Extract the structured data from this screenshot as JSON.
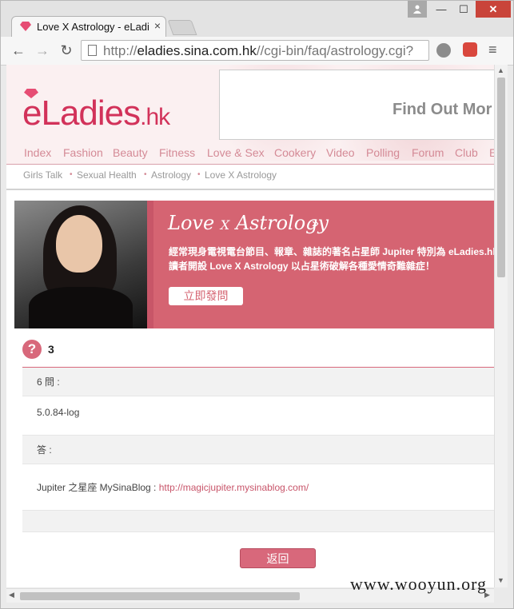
{
  "browser": {
    "tab_title": "Love X Astrology - eLadies",
    "tab_close": "×",
    "url_domain": "eladies.sina.com.hk",
    "url_path": "//cgi-bin/faq/astrology.cgi?",
    "url_scheme": "http://",
    "window_controls": {
      "minimize": "—",
      "maximize": "☐",
      "close": "✕"
    }
  },
  "site": {
    "logo_main": "eLadies",
    "logo_suffix": ".hk",
    "ad_text": "Find Out Mor",
    "nav": [
      "Index",
      "Fashion",
      "Beauty",
      "Fitness",
      "Love & Sex",
      "Cookery",
      "Video",
      "Polling",
      "Forum",
      "Club",
      "E"
    ],
    "breadcrumb": [
      "Girls Talk",
      "Sexual Health",
      "Astrology",
      "Love X Astrology"
    ]
  },
  "banner": {
    "title_love": "Love",
    "title_x": "X",
    "title_astrology": "Astrology",
    "arrow": "»",
    "description": "經常現身電視電台節目、報章、雜誌的著名占星師 Jupiter 特別為 eLadies.hk 讀者開設 Love X Astrology 以占星術破解各種愛情奇難雜症！",
    "ask_button": "立即發問"
  },
  "qa": {
    "question_icon": "?",
    "question_number": "3",
    "question_label": "6 問 :",
    "question_text": "5.0.84-log",
    "answer_label": "答 :",
    "answer_prefix": "Jupiter 之星座 MySinaBlog : ",
    "answer_link": "http://magicjupiter.mysinablog.com/",
    "back_button": "返回"
  },
  "watermark": "www.wooyun.org",
  "colors": {
    "brand_pink": "#d2325a",
    "banner_rose": "#d56472",
    "nav_pink": "#d48a96"
  }
}
